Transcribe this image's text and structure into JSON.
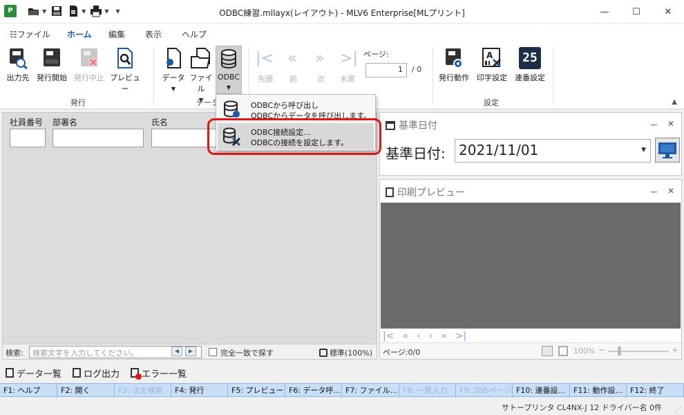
{
  "window": {
    "title": "ODBC練習.mllayx(レイアウト) - MLV6 Enterprise[MLプリント]",
    "app_icon_letter": "P"
  },
  "ribbon_tabs": [
    {
      "label": "ファイル",
      "active": false
    },
    {
      "label": "ホーム",
      "active": true
    },
    {
      "label": "編集",
      "active": false
    },
    {
      "label": "表示",
      "active": false
    },
    {
      "label": "ヘルプ",
      "active": false
    }
  ],
  "ribbon": {
    "issue_group": {
      "label": "発行",
      "buttons": [
        {
          "label": "出力先",
          "icon": "printer-search-icon",
          "enabled": true
        },
        {
          "label": "発行開始",
          "icon": "printer-start-icon",
          "enabled": true
        },
        {
          "label": "発行中止",
          "icon": "printer-stop-icon",
          "enabled": false
        },
        {
          "label": "プレビュー",
          "icon": "preview-icon",
          "enabled": true
        }
      ]
    },
    "data_group": {
      "label": "データ",
      "buttons": [
        {
          "label": "データ",
          "icon": "data-file-icon"
        },
        {
          "label": "ファイル",
          "icon": "folder-open-icon"
        },
        {
          "label": "ODBC",
          "icon": "database-icon"
        }
      ]
    },
    "nav_group": {
      "buttons": [
        {
          "label": "先頭",
          "icon": "first-icon"
        },
        {
          "label": "前",
          "icon": "prev-icon"
        },
        {
          "label": "次",
          "icon": "next-icon"
        },
        {
          "label": "末尾",
          "icon": "last-icon"
        }
      ],
      "page_label": "ページ:",
      "page_value": "1",
      "page_total": "/ 0"
    },
    "settings_group": {
      "label": "設定",
      "buttons": [
        {
          "label": "発行動作",
          "icon": "printer-gear-icon"
        },
        {
          "label": "印字設定",
          "icon": "print-setting-icon"
        },
        {
          "label": "連番設定",
          "icon": "serial-number-icon"
        }
      ],
      "serial_icon_text": "25"
    }
  },
  "odbc_menu": {
    "items": [
      {
        "title": "ODBCから呼び出し",
        "desc": "ODBCからデータを呼び出します。",
        "icon": "database-icon"
      },
      {
        "title": "ODBC接続設定...",
        "desc": "ODBCの接続を設定します。",
        "icon": "database-tools-icon",
        "selected": true
      }
    ]
  },
  "form": {
    "fields": [
      {
        "label": "社員番号"
      },
      {
        "label": "部署名"
      },
      {
        "label": "氏名"
      }
    ],
    "search_label": "検索:",
    "search_placeholder": "検索文字を入力してください。",
    "exact_match_label": "完全一致で探す",
    "zoom_label": "標準(100%)"
  },
  "date_panel": {
    "title": "基準日付",
    "label": "基準日付:",
    "value": "2021/11/01"
  },
  "preview_panel": {
    "title": "印刷プレビュー",
    "page_info": "ページ:0/0",
    "zoom": "100%"
  },
  "bottom_tabs": [
    {
      "label": "データ一覧",
      "icon": "data-list-icon"
    },
    {
      "label": "ログ出力",
      "icon": "log-icon"
    },
    {
      "label": "エラー一覧",
      "icon": "error-list-icon"
    }
  ],
  "function_keys": [
    {
      "label": "F1: ヘルプ",
      "enabled": true
    },
    {
      "label": "F2: 開く",
      "enabled": true
    },
    {
      "label": "F3: 次を検索",
      "enabled": false
    },
    {
      "label": "F4: 発行",
      "enabled": true
    },
    {
      "label": "F5: プレビュー",
      "enabled": true
    },
    {
      "label": "F6: データ呼...",
      "enabled": true
    },
    {
      "label": "F7: ファイル...",
      "enabled": true
    },
    {
      "label": "F8: 一覧入力",
      "enabled": false
    },
    {
      "label": "F9: 次のページ",
      "enabled": false
    },
    {
      "label": "F10: 連番設...",
      "enabled": true
    },
    {
      "label": "F11: 動作設...",
      "enabled": true
    },
    {
      "label": "F12: 終了",
      "enabled": true
    }
  ],
  "status": {
    "text": "サトープリンタ CL4NX-J 12 ドライバー名 0件"
  },
  "colors": {
    "accent": "#1a5aa6",
    "fkey_bar": "#c9dff8",
    "highlight": "#e21414"
  }
}
